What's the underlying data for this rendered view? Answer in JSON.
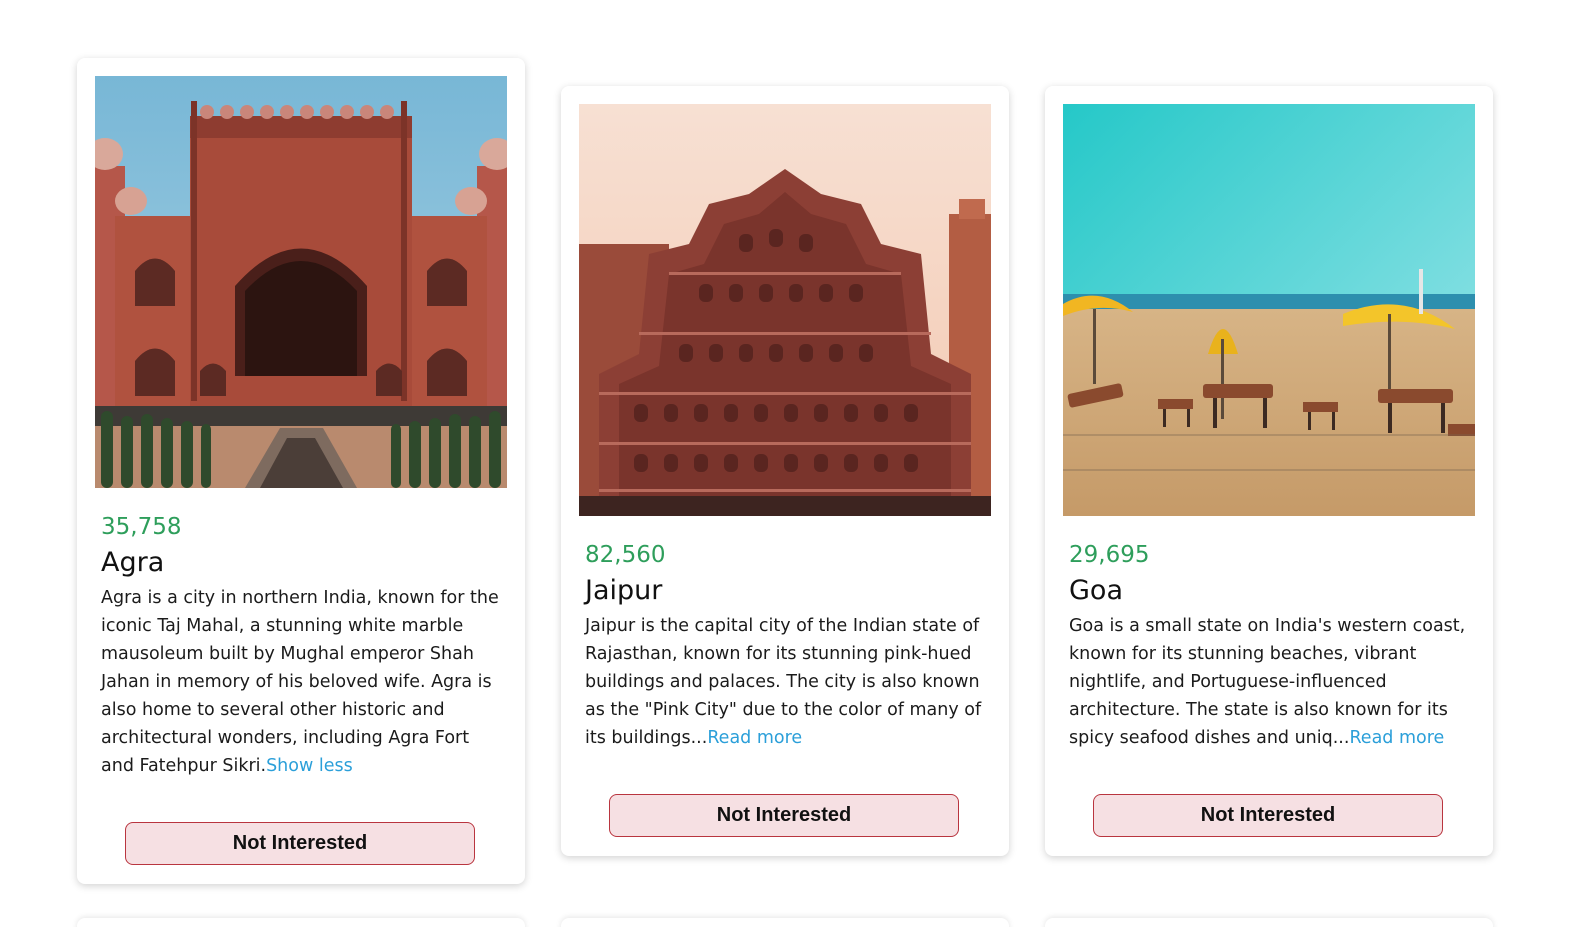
{
  "tours": [
    {
      "price": "35,758",
      "name": "Agra",
      "info": "Agra is a city in northern India, known for the iconic Taj Mahal, a stunning white marble mausoleum built by Mughal emperor Shah Jahan in memory of his beloved wife. Agra is also home to several other historic and architectural wonders, including Agra Fort and Fatehpur Sikri.",
      "toggle_label": "Show less",
      "button_label": "Not Interested"
    },
    {
      "price": "82,560",
      "name": "Jaipur",
      "info": "Jaipur is the capital city of the Indian state of Rajasthan, known for its stunning pink-hued buildings and palaces. The city is also known as the \"Pink City\" due to the color of many of its buildings...",
      "toggle_label": "Read more",
      "button_label": "Not Interested"
    },
    {
      "price": "29,695",
      "name": "Goa",
      "info": "Goa is a small state on India's western coast, known for its stunning beaches, vibrant nightlife, and Portuguese-influenced architecture. The state is also known for its spicy seafood dishes and uniq...",
      "toggle_label": "Read more",
      "button_label": "Not Interested"
    }
  ],
  "colors": {
    "price": "#2e9e5b",
    "link": "#2b9fd9",
    "button_bg": "#f6e0e3",
    "button_border": "#b9353f"
  }
}
